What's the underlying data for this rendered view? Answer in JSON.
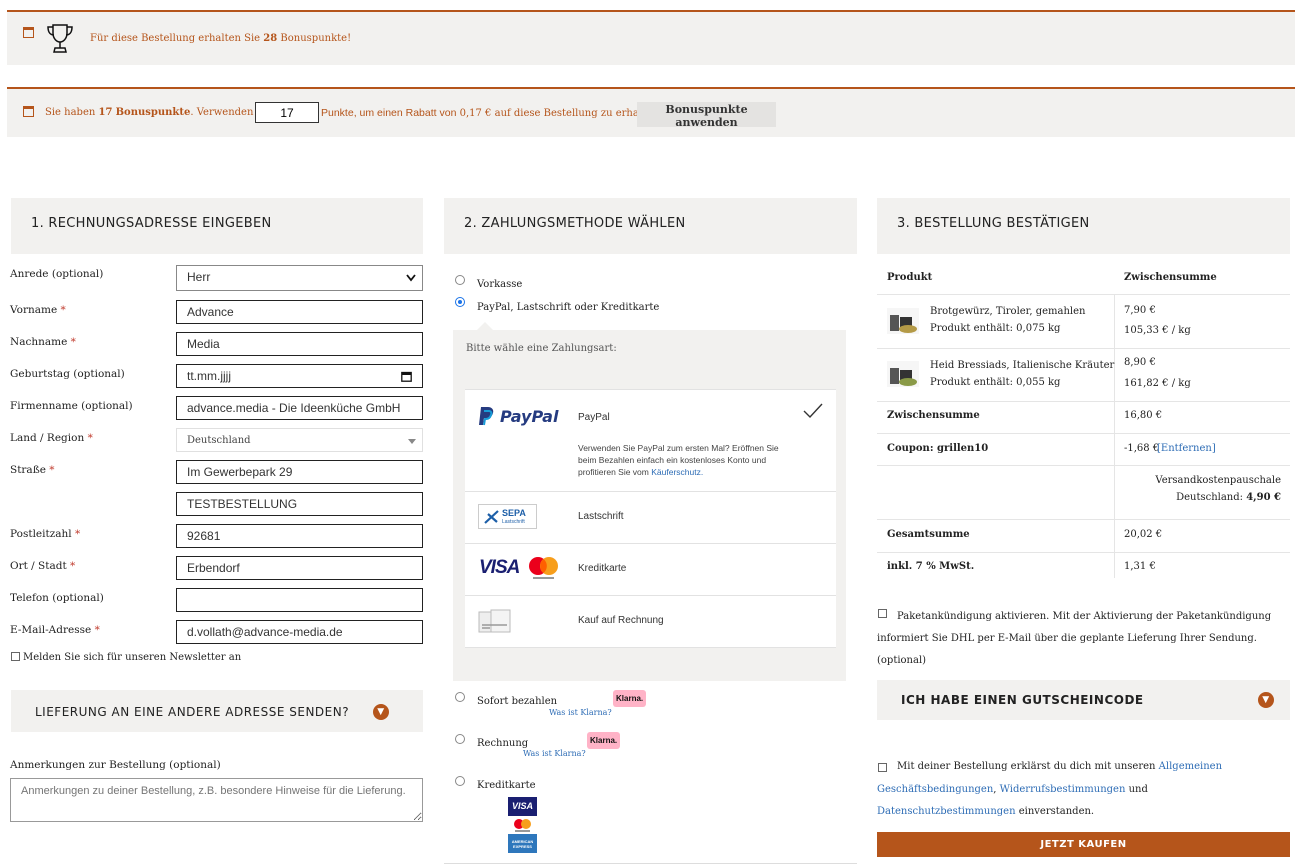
{
  "bonus_earn": {
    "prefix": "Für diese Bestellung erhalten Sie",
    "points": "28",
    "suffix": "Bonuspunkte!"
  },
  "bonus_use": {
    "prefix": "Sie haben",
    "points": "17",
    "points_label": "Bonuspunkte",
    "mid": ". Verwenden Sie",
    "input_value": "17",
    "after_input": "Punkte, um einen Rabatt von",
    "discount": "0,17 €",
    "after_discount": "auf diese Bestellung zu erhalten.",
    "button": "Bonuspunkte anwenden"
  },
  "billing": {
    "heading": "1. RECHNUNGSADRESSE EINGEBEN",
    "anrede_label": "Anrede (optional)",
    "anrede_value": "Herr",
    "vorname_label": "Vorname",
    "vorname_value": "Advance",
    "nachname_label": "Nachname",
    "nachname_value": "Media",
    "geburtstag_label": "Geburtstag (optional)",
    "geburtstag_placeholder": "tt.mm.jjjj",
    "firma_label": "Firmenname (optional)",
    "firma_value": "advance.media - Die Ideenküche GmbH",
    "land_label": "Land / Region",
    "land_value": "Deutschland",
    "strasse_label": "Straße",
    "strasse_value": "Im Gewerbepark 29",
    "strasse2_value": "TESTBESTELLUNG",
    "plz_label": "Postleitzahl",
    "plz_value": "92681",
    "ort_label": "Ort / Stadt",
    "ort_value": "Erbendorf",
    "telefon_label": "Telefon (optional)",
    "telefon_value": "",
    "email_label": "E-Mail-Adresse",
    "email_value": "d.vollath@advance-media.de",
    "newsletter_label": "Melden Sie sich für unseren Newsletter an",
    "required_mark": "*"
  },
  "shipping_toggle": "LIEFERUNG AN EINE ANDERE ADRESSE SENDEN?",
  "notes": {
    "label": "Anmerkungen zur Bestellung (optional)",
    "placeholder": "Anmerkungen zu deiner Bestellung, z.B. besondere Hinweise für die Lieferung."
  },
  "payment": {
    "heading": "2. ZAHLUNGSMETHODE WÄHLEN",
    "vorkasse": "Vorkasse",
    "paypal_option": "PayPal, Lastschrift oder Kreditkarte",
    "choose_prompt": "Bitte wähle eine Zahlungsart:",
    "paypal_logo": "PayPal",
    "paypal_name": "PayPal",
    "paypal_desc": "Verwenden Sie PayPal zum ersten Mal? Eröffnen Sie beim Bezahlen einfach ein kostenloses Konto und profitieren Sie vom",
    "paypal_link": "Käuferschutz.",
    "sepa_logo": "SEPA",
    "sepa_sub": "Lastschrift",
    "lastschrift": "Lastschrift",
    "visa_logo": "VISA",
    "kreditkarte": "Kreditkarte",
    "rechnung_kauf": "Kauf auf Rechnung",
    "sofort": "Sofort bezahlen",
    "klarna_badge": "Klarna.",
    "klarna_link": "Was ist Klarna?",
    "rechnung": "Rechnung",
    "kreditkarte2": "Kreditkarte",
    "card_visa": "VISA",
    "card_amex": "AMERICAN EXPRESS"
  },
  "summary": {
    "heading": "3. BESTELLUNG BESTÄTIGEN",
    "col_product": "Produkt",
    "col_subtotal": "Zwischensumme",
    "items": [
      {
        "name": "Brotgewürz, Tiroler, gemahlen",
        "content": "Produkt enthält: 0,075 kg",
        "price": "7,90 €",
        "unit": "105,33 € / kg"
      },
      {
        "name": "Heid Bressiads, Italienische Kräuter",
        "content": "Produkt enthält: 0,055 kg",
        "price": "8,90 €",
        "unit": "161,82 € / kg"
      }
    ],
    "subtotal_label": "Zwischensumme",
    "subtotal_value": "16,80 €",
    "coupon_label": "Coupon: grillen10",
    "coupon_value": "-1,68 €",
    "coupon_remove": "[Entfernen]",
    "shipping_line1": "Versandkostenpauschale",
    "shipping_line2": "Deutschland:",
    "shipping_value": "4,90 €",
    "total_label": "Gesamtsumme",
    "total_value": "20,02 €",
    "tax_label": "inkl. 7 % MwSt.",
    "tax_value": "1,31 €",
    "dhl_text": "Paketankündigung aktivieren. Mit der Aktivierung der Paketankündigung informiert Sie DHL per E-Mail über die geplante Lieferung Ihrer Sendung. (optional)",
    "coupon_toggle": "ICH HABE EINEN GUTSCHEINCODE",
    "terms_prefix": "Mit deiner Bestellung erklärst du dich mit unseren",
    "terms_agb": "Allgemeinen Geschäftsbedingungen",
    "terms_comma": ",",
    "terms_widerruf": "Widerrufsbestimmungen",
    "terms_and": "und",
    "terms_datenschutz": "Datenschutzbestimmungen",
    "terms_suffix": "einverstanden.",
    "buy_button": "JETZT KAUFEN"
  },
  "colors": {
    "accent": "#b5551b",
    "panel": "#f2f1ef",
    "link": "#2d6cb5",
    "paypal_dark": "#253b80",
    "paypal_light": "#179bd7"
  }
}
